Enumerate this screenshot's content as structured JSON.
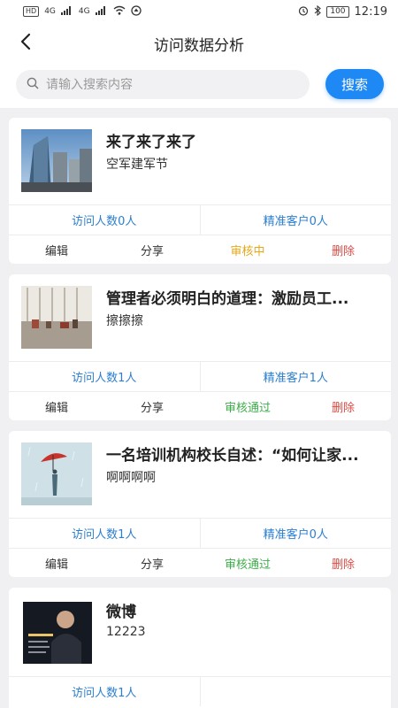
{
  "status_bar": {
    "left_tag": "HD",
    "net1": "4G",
    "net2": "4G",
    "battery": "100",
    "time": "12:19"
  },
  "header": {
    "title": "访问数据分析"
  },
  "search": {
    "placeholder": "请输入搜索内容",
    "button_label": "搜索"
  },
  "articles": [
    {
      "title": "来了来了来了",
      "subtitle": "空军建军节",
      "visitors": "访问人数0人",
      "customers": "精准客户0人",
      "edit": "编辑",
      "share": "分享",
      "status": "审核中",
      "delete": "删除"
    },
    {
      "title": "管理者必须明白的道理：激励员工...",
      "subtitle": "擦擦擦",
      "visitors": "访问人数1人",
      "customers": "精准客户1人",
      "edit": "编辑",
      "share": "分享",
      "status": "审核通过",
      "delete": "删除"
    },
    {
      "title": "一名培训机构校长自述：“如何让家...",
      "subtitle": "啊啊啊啊",
      "visitors": "访问人数1人",
      "customers": "精准客户0人",
      "edit": "编辑",
      "share": "分享",
      "status": "审核通过",
      "delete": "删除"
    },
    {
      "title": "微博",
      "subtitle": "12223",
      "visitors": "访问人数1人",
      "customers": ""
    }
  ],
  "colors": {
    "accent": "#1e88f5",
    "stat_text": "#2c7fd0",
    "pending": "#e6a817",
    "approved": "#3dad4a",
    "delete": "#e04a44"
  }
}
